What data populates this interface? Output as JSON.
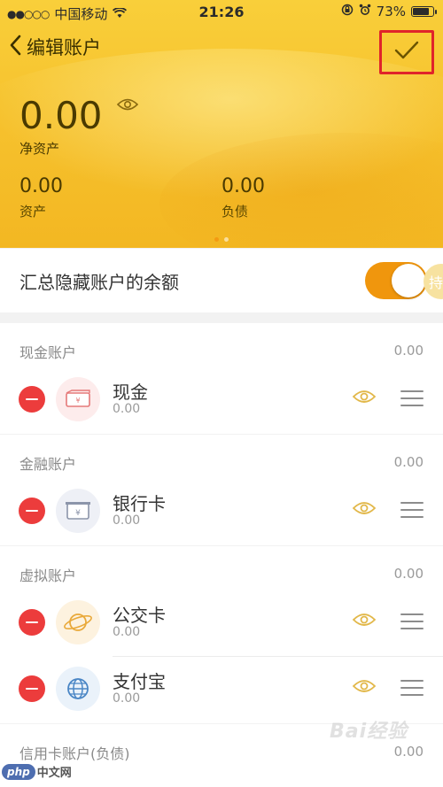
{
  "status_bar": {
    "signal": "●●○○○",
    "carrier": "中国移动",
    "time": "21:26",
    "battery": "73%"
  },
  "nav": {
    "title": "编辑账户"
  },
  "summary": {
    "net_value": "0.00",
    "net_label": "净资产",
    "assets_value": "0.00",
    "assets_label": "资产",
    "debt_value": "0.00",
    "debt_label": "负债"
  },
  "toggle": {
    "label": "汇总隐藏账户的余额",
    "on": true,
    "peek_text": "持"
  },
  "sections": [
    {
      "name": "现金账户",
      "total": "0.00",
      "items": [
        {
          "name": "现金",
          "value": "0.00",
          "icon": "cash-icon"
        }
      ]
    },
    {
      "name": "金融账户",
      "total": "0.00",
      "items": [
        {
          "name": "银行卡",
          "value": "0.00",
          "icon": "bank-card-icon"
        }
      ]
    },
    {
      "name": "虚拟账户",
      "total": "0.00",
      "items": [
        {
          "name": "公交卡",
          "value": "0.00",
          "icon": "planet-icon"
        },
        {
          "name": "支付宝",
          "value": "0.00",
          "icon": "globe-icon"
        }
      ]
    },
    {
      "name": "信用卡账户(负债)",
      "total": "0.00",
      "items": []
    }
  ],
  "watermark": {
    "text": "Bai经验",
    "logo_badge": "php",
    "logo_text": "中文网"
  },
  "colors": {
    "header_yellow": "#f6c22e",
    "toggle_orange": "#f0960d",
    "delete_red": "#ec3c3c",
    "highlight_box": "#e0242a",
    "eye_gold": "#e2b84a"
  }
}
